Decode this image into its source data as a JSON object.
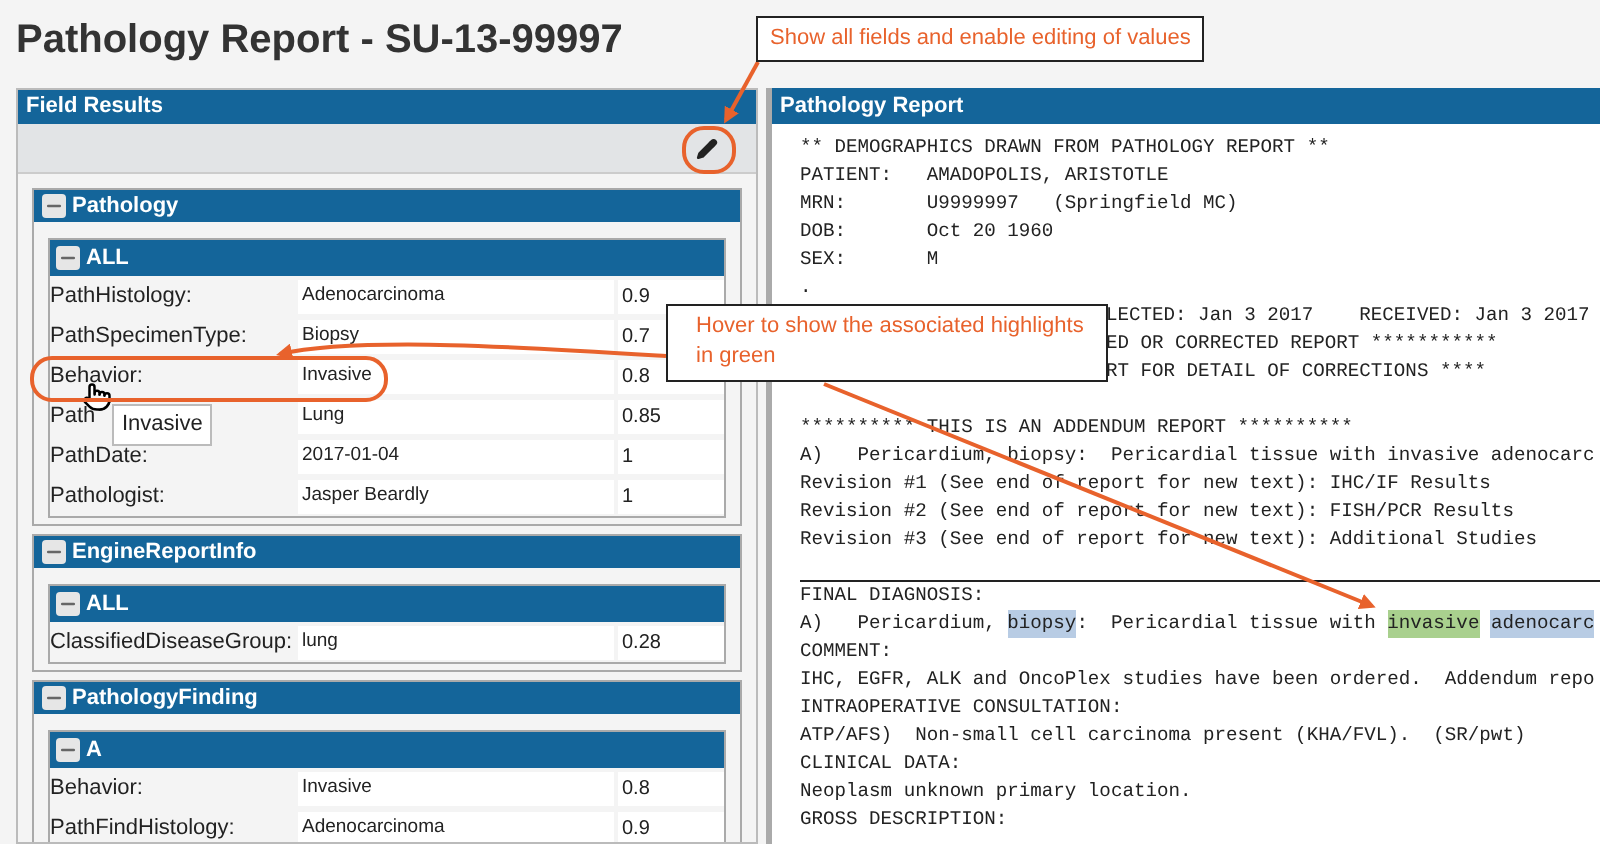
{
  "page_title": "Pathology Report - SU-13-99997",
  "field_results": {
    "title": "Field Results",
    "sections": [
      {
        "title": "Pathology",
        "expanded": true,
        "groups": [
          {
            "title": "ALL",
            "expanded": true,
            "rows": [
              {
                "label": "PathHistology:",
                "value": "Adenocarcinoma",
                "score": "0.9"
              },
              {
                "label": "PathSpecimenType:",
                "value": "Biopsy",
                "score": "0.7"
              },
              {
                "label": "Behavior:",
                "value": "Invasive",
                "score": "0.8"
              },
              {
                "label": "Path",
                "value": "Lung",
                "score": "0.85"
              },
              {
                "label": "PathDate:",
                "value": "2017-01-04",
                "score": "1"
              },
              {
                "label": "Pathologist:",
                "value": "Jasper Beardly",
                "score": "1"
              }
            ]
          }
        ]
      },
      {
        "title": "EngineReportInfo",
        "expanded": true,
        "groups": [
          {
            "title": "ALL",
            "expanded": true,
            "rows": [
              {
                "label": "ClassifiedDiseaseGroup:",
                "value": "lung",
                "score": "0.28"
              }
            ]
          }
        ]
      },
      {
        "title": "PathologyFinding",
        "expanded": true,
        "groups": [
          {
            "title": "A",
            "expanded": true,
            "rows": [
              {
                "label": "Behavior:",
                "value": "Invasive",
                "score": "0.8"
              },
              {
                "label": "PathFindHistology:",
                "value": "Adenocarcinoma",
                "score": "0.9"
              }
            ]
          }
        ]
      }
    ]
  },
  "hover_tooltip": "Invasive",
  "report": {
    "title": "Pathology Report",
    "lines": [
      {
        "kind": "text",
        "text": "** DEMOGRAPHICS DRAWN FROM PATHOLOGY REPORT **"
      },
      {
        "kind": "text",
        "text": "PATIENT:   AMADOPOLIS, ARISTOTLE"
      },
      {
        "kind": "text",
        "text": "MRN:       U9999997   (Springfield MC)"
      },
      {
        "kind": "text",
        "text": "DOB:       Oct 20 1960"
      },
      {
        "kind": "text",
        "text": "SEX:       M"
      },
      {
        "kind": "text",
        "text": "."
      },
      {
        "kind": "covered",
        "text": "LECTED: Jan 3 2017    RECEIVED: Jan 3 2017"
      },
      {
        "kind": "covered",
        "text": "ED OR CORRECTED REPORT ***********"
      },
      {
        "kind": "covered",
        "text": "RT FOR DETAIL OF CORRECTIONS ****"
      },
      {
        "kind": "blank"
      },
      {
        "kind": "text",
        "text": "********** THIS IS AN ADDENDUM REPORT **********"
      },
      {
        "kind": "text",
        "text": "A)   Pericardium, biopsy:  Pericardial tissue with invasive adenocarc"
      },
      {
        "kind": "text",
        "text": "Revision #1 (See end of report for new text): IHC/IF Results"
      },
      {
        "kind": "text",
        "text": "Revision #2 (See end of report for new text): FISH/PCR Results"
      },
      {
        "kind": "text",
        "text": "Revision #3 (See end of report for new text): Additional Studies"
      },
      {
        "kind": "rule"
      },
      {
        "kind": "text",
        "text": "FINAL DIAGNOSIS:"
      },
      {
        "kind": "segments",
        "segments": [
          {
            "text": "A)   Pericardium, ",
            "kind": "plain"
          },
          {
            "text": "biopsy",
            "kind": "related"
          },
          {
            "text": ":  Pericardial tissue with ",
            "kind": "plain"
          },
          {
            "text": "invasive",
            "kind": "hovered"
          },
          {
            "text": "adenocarc",
            "kind": "related"
          }
        ]
      },
      {
        "kind": "text",
        "text": "COMMENT:"
      },
      {
        "kind": "text",
        "text": "IHC, EGFR, ALK and OncoPlex studies have been ordered.  Addendum repo"
      },
      {
        "kind": "text",
        "text": "INTRAOPERATIVE CONSULTATION:"
      },
      {
        "kind": "text",
        "text": "ATP/AFS)  Non-small cell carcinoma present (KHA/FVL).  (SR/pwt)"
      },
      {
        "kind": "text",
        "text": "CLINICAL DATA:"
      },
      {
        "kind": "text",
        "text": "Neoplasm unknown primary location."
      },
      {
        "kind": "text",
        "text": "GROSS DESCRIPTION:"
      }
    ]
  },
  "callouts": [
    {
      "text": "Show all fields and enable editing of values"
    },
    {
      "text": "Hover to show the associated highlights in green"
    }
  ]
}
